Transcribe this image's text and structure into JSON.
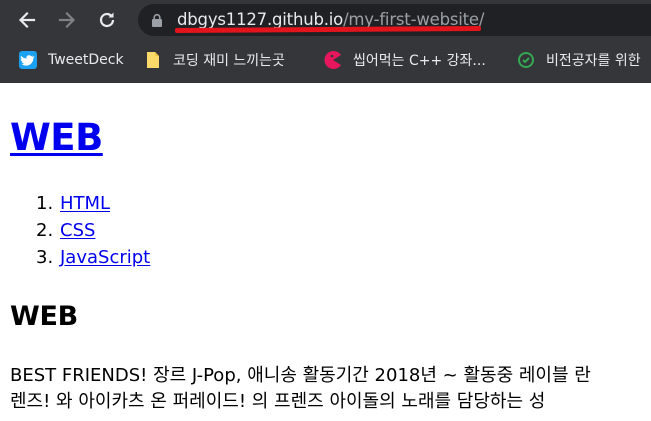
{
  "browser": {
    "address_bar": {
      "host": "dbgys1127.github.io",
      "path": "/my-first-website/"
    },
    "bookmarks": [
      {
        "label": "TweetDeck",
        "icon": "twitter-icon"
      },
      {
        "label": "코딩 재미 느끼는곳",
        "icon": "folder-icon"
      },
      {
        "label": "씹어먹는 C++ 강좌...",
        "icon": "pacman-icon"
      },
      {
        "label": "비전공자를 위한",
        "icon": "site-icon"
      }
    ],
    "colors": {
      "chrome_bg": "#35363a",
      "omnibox_bg": "#202124",
      "annotation_underline": "#e3141c"
    }
  },
  "page": {
    "title_link": "WEB",
    "list": [
      {
        "num": "1.",
        "label": "HTML"
      },
      {
        "num": "2.",
        "label": "CSS"
      },
      {
        "num": "3.",
        "label": "JavaScript"
      }
    ],
    "heading": "WEB",
    "paragraph_line1": "BEST FRIENDS! 장르 J-Pop, 애니송 활동기간 2018년 ~ 활동중 레이블 란",
    "paragraph_line2": "렌즈! 와 아이카츠 온 퍼레이드! 의 프렌즈 아이돌의 노래를 담당하는 성",
    "link_color": "#0000ee"
  }
}
